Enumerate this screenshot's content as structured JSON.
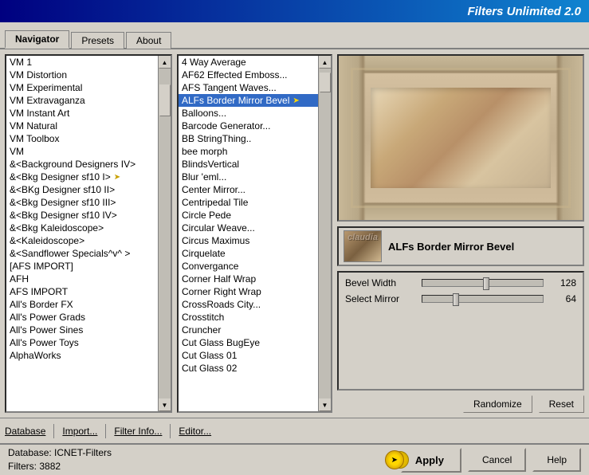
{
  "titleBar": {
    "title": "Filters Unlimited 2.0"
  },
  "tabs": [
    {
      "id": "navigator",
      "label": "Navigator",
      "active": true
    },
    {
      "id": "presets",
      "label": "Presets",
      "active": false
    },
    {
      "id": "about",
      "label": "About",
      "active": false
    }
  ],
  "leftList": {
    "items": [
      {
        "label": "VM 1",
        "selected": false,
        "arrow": false
      },
      {
        "label": "VM Distortion",
        "selected": false,
        "arrow": false
      },
      {
        "label": "VM Experimental",
        "selected": false,
        "arrow": false
      },
      {
        "label": "VM Extravaganza",
        "selected": false,
        "arrow": false
      },
      {
        "label": "VM Instant Art",
        "selected": false,
        "arrow": false
      },
      {
        "label": "VM Natural",
        "selected": false,
        "arrow": false
      },
      {
        "label": "VM Toolbox",
        "selected": false,
        "arrow": false
      },
      {
        "label": "VM",
        "selected": false,
        "arrow": false
      },
      {
        "label": "&<Background Designers IV>",
        "selected": false,
        "arrow": false
      },
      {
        "label": "&<Bkg Designer sf10 I>",
        "selected": false,
        "arrow": true
      },
      {
        "label": "&<BKg Designer sf10 II>",
        "selected": false,
        "arrow": false
      },
      {
        "label": "&<Bkg Designer sf10 III>",
        "selected": false,
        "arrow": false
      },
      {
        "label": "&<Bkg Designer sf10 IV>",
        "selected": false,
        "arrow": false
      },
      {
        "label": "&<Bkg Kaleidoscope>",
        "selected": false,
        "arrow": false
      },
      {
        "label": "&<Kaleidoscope>",
        "selected": false,
        "arrow": false
      },
      {
        "label": "&<Sandflower Specials^v^ >",
        "selected": false,
        "arrow": false
      },
      {
        "label": "[AFS IMPORT]",
        "selected": false,
        "arrow": false
      },
      {
        "label": "AFH",
        "selected": false,
        "arrow": false
      },
      {
        "label": "AFS IMPORT",
        "selected": false,
        "arrow": false
      },
      {
        "label": "All's Border FX",
        "selected": false,
        "arrow": false
      },
      {
        "label": "All's Power Grads",
        "selected": false,
        "arrow": false
      },
      {
        "label": "All's Power Sines",
        "selected": false,
        "arrow": false
      },
      {
        "label": "All's Power Toys",
        "selected": false,
        "arrow": false
      },
      {
        "label": "AlphaWorks",
        "selected": false,
        "arrow": false
      }
    ]
  },
  "middleList": {
    "items": [
      {
        "label": "4 Way Average",
        "selected": false
      },
      {
        "label": "AF62 Effected Emboss...",
        "selected": false
      },
      {
        "label": "AFS Tangent Waves...",
        "selected": false
      },
      {
        "label": "ALFs Border Mirror Bevel",
        "selected": true
      },
      {
        "label": "Balloons...",
        "selected": false
      },
      {
        "label": "Barcode Generator...",
        "selected": false
      },
      {
        "label": "BB StringThing..",
        "selected": false
      },
      {
        "label": "bee morph",
        "selected": false
      },
      {
        "label": "BlindsVertical",
        "selected": false
      },
      {
        "label": "Blur 'eml...",
        "selected": false
      },
      {
        "label": "Center Mirror...",
        "selected": false
      },
      {
        "label": "Centripedal Tile",
        "selected": false
      },
      {
        "label": "Circle Pede",
        "selected": false
      },
      {
        "label": "Circular Weave...",
        "selected": false
      },
      {
        "label": "Circus Maximus",
        "selected": false
      },
      {
        "label": "Cirquelate",
        "selected": false
      },
      {
        "label": "Convergance",
        "selected": false
      },
      {
        "label": "Corner Half Wrap",
        "selected": false
      },
      {
        "label": "Corner Right Wrap",
        "selected": false
      },
      {
        "label": "CrossRoads City...",
        "selected": false
      },
      {
        "label": "Crosstitch",
        "selected": false
      },
      {
        "label": "Cruncher",
        "selected": false
      },
      {
        "label": "Cut Glass  BugEye",
        "selected": false
      },
      {
        "label": "Cut Glass 01",
        "selected": false
      },
      {
        "label": "Cut Glass 02",
        "selected": false
      }
    ]
  },
  "filterInfo": {
    "name": "ALFs Border Mirror Bevel",
    "thumbnailText": "claudia"
  },
  "params": [
    {
      "label": "Bevel Width",
      "value": 128,
      "max": 255,
      "fillPct": 50
    },
    {
      "label": "Select Mirror",
      "value": 64,
      "max": 255,
      "fillPct": 25
    }
  ],
  "bottomActions": [
    {
      "label": "Database",
      "underline": true
    },
    {
      "label": "Import...",
      "underline": true
    },
    {
      "label": "Filter Info...",
      "underline": true
    },
    {
      "label": "Editor...",
      "underline": true
    }
  ],
  "rightBottomBtns": {
    "randomize": "Randomize",
    "reset": "Reset"
  },
  "footer": {
    "databaseLabel": "Database:",
    "databaseValue": "ICNET-Filters",
    "filtersLabel": "Filters:",
    "filtersValue": "3882",
    "applyBtn": "Apply",
    "cancelBtn": "Cancel",
    "helpBtn": "Help"
  }
}
